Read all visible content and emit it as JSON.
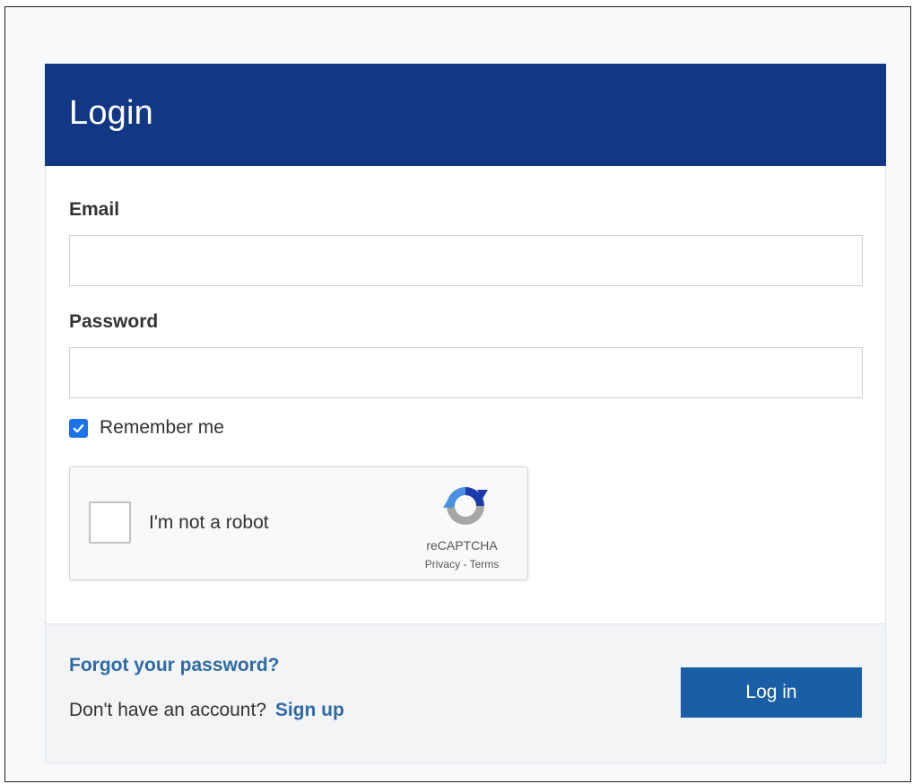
{
  "card": {
    "title": "Login"
  },
  "form": {
    "email_label": "Email",
    "email_value": "",
    "password_label": "Password",
    "password_value": "",
    "remember_label": "Remember me",
    "remember_checked": true
  },
  "recaptcha": {
    "text": "I'm not a robot",
    "brand": "reCAPTCHA",
    "privacy": "Privacy",
    "separator": " - ",
    "terms": "Terms",
    "logo_icon": "recaptcha-logo-icon"
  },
  "footer": {
    "forgot_label": "Forgot your password?",
    "no_account_text": "Don't have an account?",
    "signup_label": "Sign up",
    "login_label": "Log in"
  },
  "colors": {
    "header_bg": "#123785",
    "link": "#2f6aa5",
    "primary_button": "#1a5fa6",
    "checkbox": "#1a73e8"
  }
}
